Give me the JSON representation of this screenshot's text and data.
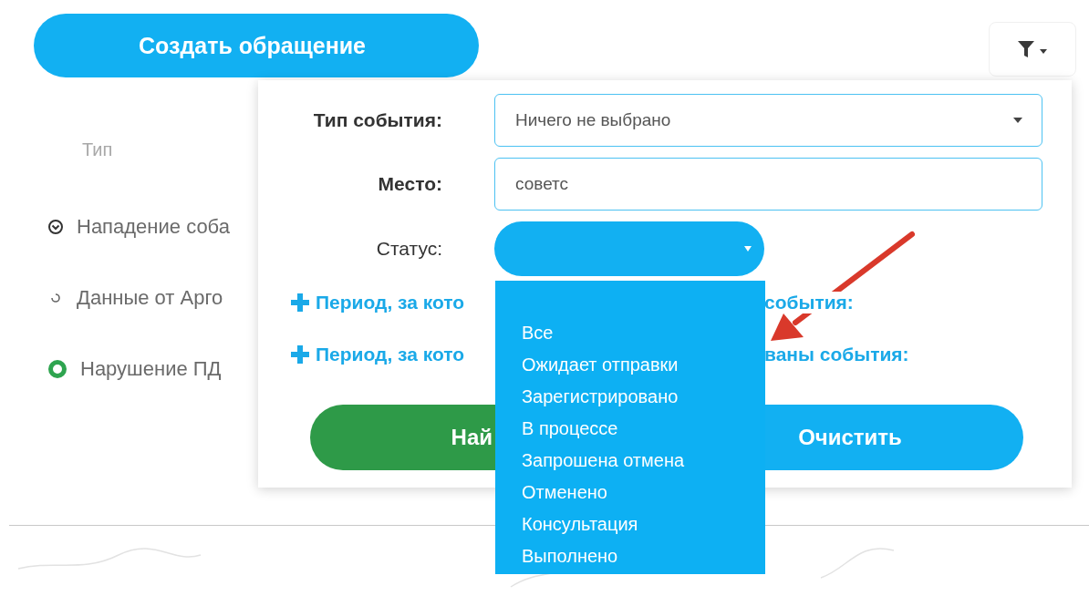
{
  "create_button": "Создать обращение",
  "table": {
    "column_header": "Тип",
    "rows": [
      {
        "kind": "chevron",
        "type": "Нападение соба"
      },
      {
        "kind": "spinner",
        "type": "Данные от Арго"
      },
      {
        "kind": "ring",
        "type": "Нарушение ПД"
      }
    ]
  },
  "filter_panel": {
    "fields": [
      {
        "kind": "select",
        "label": "Тип события:",
        "bold": true,
        "value": "Ничего не выбрано"
      },
      {
        "kind": "text",
        "label": "Место:",
        "bold": true,
        "value": "советс"
      },
      {
        "kind": "status",
        "label": "Статус:",
        "bold": false,
        "expanded": true
      }
    ],
    "period_links": [
      {
        "part_1": "Период, за кото",
        "part_2": "события:"
      },
      {
        "part_1": "Период, за кото",
        "part_2": "ваны события:"
      }
    ],
    "buttons": [
      {
        "kind": "search",
        "label": "Най"
      },
      {
        "kind": "clear",
        "label": "Очистить"
      }
    ],
    "status_options": [
      "Все",
      "Ожидает отправки",
      "Зарегистрировано",
      "В процессе",
      "Запрошена отмена",
      "Отменено",
      "Консультация",
      "Выполнено"
    ]
  }
}
